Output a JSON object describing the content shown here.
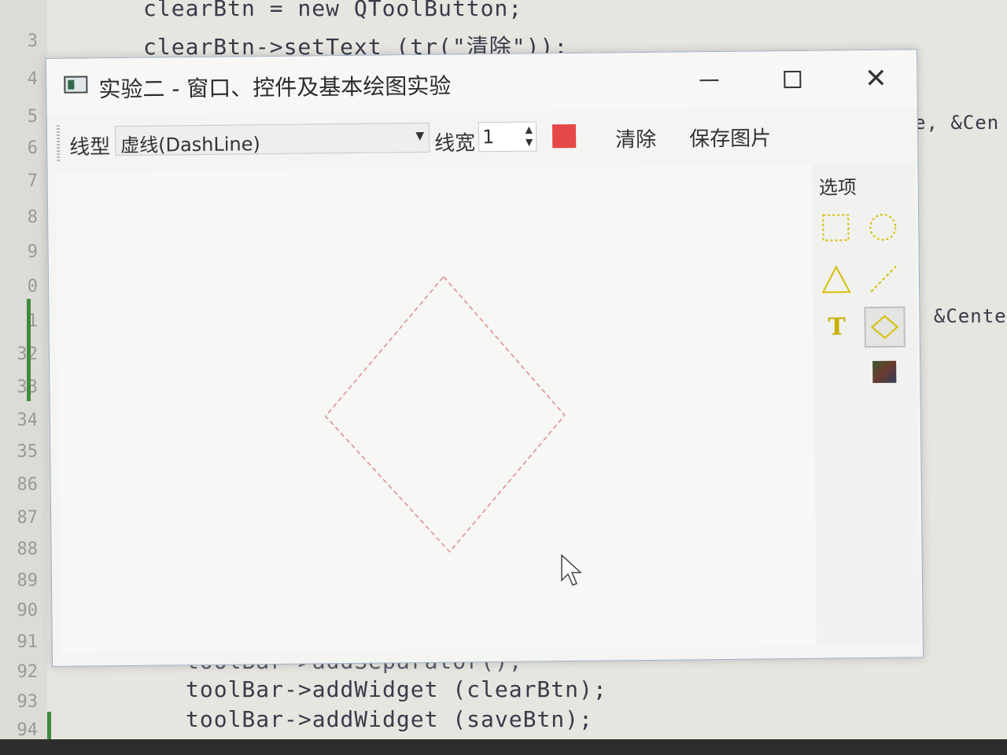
{
  "editor": {
    "line_numbers": [
      "3",
      "4",
      "5",
      "6",
      "7",
      "8",
      "9",
      "0",
      "1",
      "32",
      "33",
      "34",
      "35",
      "86",
      "87",
      "88",
      "89",
      "90",
      "91",
      "92",
      "93",
      "94"
    ],
    "code_lines": [
      "clearBtn = new QToolButton;",
      "clearBtn->setText (tr(\"清除\"));",
      "toolBar->addSeparator();",
      "toolBar->addWidget (clearBtn);",
      "toolBar->addWidget (saveBtn);"
    ],
    "side_text_1": "e, &Cen",
    "side_text_2": ", &Cente"
  },
  "window": {
    "title": "实验二 - 窗口、控件及基本绘图实验",
    "minimize_glyph": "—",
    "close_glyph": "✕"
  },
  "toolbar": {
    "line_style_label": "线型",
    "line_style_value": "虚线(DashLine)",
    "line_width_label": "线宽",
    "line_width_value": "1",
    "pen_color": "#e64848",
    "clear_label": "清除",
    "save_label": "保存图片"
  },
  "options": {
    "title": "选项",
    "tool_text_glyph": "T",
    "tools": [
      "rectangle-tool",
      "ellipse-tool",
      "triangle-tool",
      "line-tool",
      "text-tool",
      "diamond-tool",
      "image-tool"
    ],
    "selected_tool": "diamond-tool",
    "icon_color": "#d4c000"
  },
  "canvas": {
    "shape": "diamond",
    "stroke_color": "#e08a8a",
    "stroke_style": "dashed"
  }
}
